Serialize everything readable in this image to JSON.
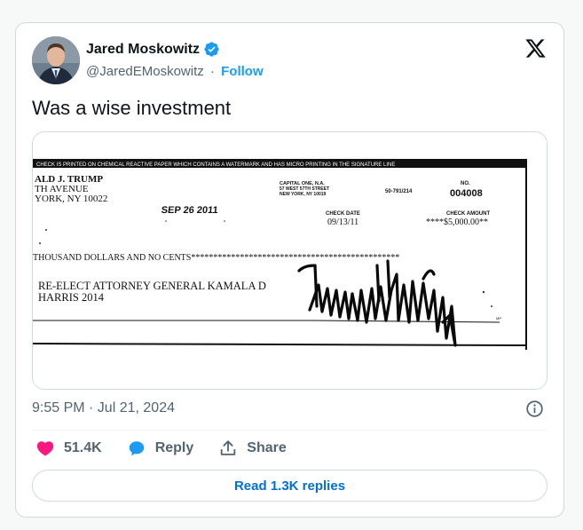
{
  "tweet": {
    "author_name": "Jared Moskowitz",
    "handle": "@JaredEMoskowitz",
    "separator": "·",
    "follow_label": "Follow",
    "text": "Was a wise investment",
    "timestamp": "9:55 PM · Jul 21, 2024",
    "icons": {
      "verified": "verified-badge-icon",
      "platform": "x-logo-icon",
      "info": "info-icon"
    },
    "colors": {
      "accent": "#1d9bf0",
      "like": "#f91880",
      "reply": "#1d9bf0",
      "link": "#006fd6"
    }
  },
  "actions": {
    "likes_count": "51.4K",
    "reply_label": "Reply",
    "share_label": "Share"
  },
  "read_replies_label": "Read 1.3K replies",
  "check": {
    "header": "CHECK IS PRINTED ON CHEMICAL REACTIVE PAPER WHICH CONTAINS A WATERMARK AND HAS MICRO PRINTING IN THE SIGNATURE LINE",
    "payer_line1": "ALD J. TRUMP",
    "payer_line2": "TH AVENUE",
    "payer_line3": "YORK, NY 10022",
    "bank_line1": "CAPITAL ONE, N.A.",
    "bank_line2": "57 WEST 57TH STREET",
    "bank_line3": "NEW YORK, NY 10019",
    "routing": "50-791/214",
    "no_label": "NO.",
    "check_number": "004008",
    "stamp_date": "SEP 26 2011",
    "date_label": "CHECK DATE",
    "date_value": "09/13/11",
    "amount_label": "CHECK AMOUNT",
    "amount_value": "****$5,000.00**",
    "amount_words": "THOUSAND DOLLARS AND NO CENTS***********************************************",
    "payee_line1": "RE-ELECT ATTORNEY GENERAL KAMALA D",
    "payee_line2": "HARRIS 2014",
    "mp_mark": "MP"
  }
}
